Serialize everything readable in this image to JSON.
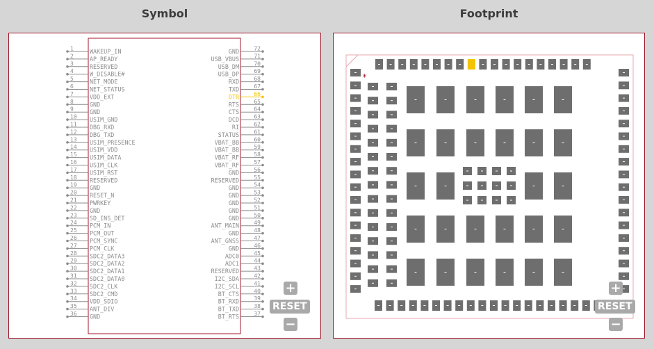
{
  "symbol_title": "Symbol",
  "footprint_title": "Footprint",
  "controls": {
    "plus": "+",
    "reset": "RESET",
    "minus": "−"
  },
  "colors": {
    "border": "#a0182c",
    "pin": "#8c8c8c",
    "highlight": "#f5c400",
    "pad": "#6e6e6e"
  },
  "symbol": {
    "left_pins": [
      {
        "num": "1",
        "name": "WAKEUP_IN"
      },
      {
        "num": "2",
        "name": "AP_READY"
      },
      {
        "num": "3",
        "name": "RESERVED"
      },
      {
        "num": "4",
        "name": "W_DISABLE#"
      },
      {
        "num": "5",
        "name": "NET_MODE"
      },
      {
        "num": "6",
        "name": "NET_STATUS"
      },
      {
        "num": "7",
        "name": "VDD_EXT"
      },
      {
        "num": "8",
        "name": "GND"
      },
      {
        "num": "9",
        "name": "GND"
      },
      {
        "num": "10",
        "name": "USIM_GND"
      },
      {
        "num": "11",
        "name": "DBG_RXD"
      },
      {
        "num": "12",
        "name": "DBG_TXD"
      },
      {
        "num": "13",
        "name": "USIM_PRESENCE"
      },
      {
        "num": "14",
        "name": "USIM_VDD"
      },
      {
        "num": "15",
        "name": "USIM_DATA"
      },
      {
        "num": "16",
        "name": "USIM_CLK"
      },
      {
        "num": "17",
        "name": "USIM_RST"
      },
      {
        "num": "18",
        "name": "RESERVED"
      },
      {
        "num": "19",
        "name": "GND"
      },
      {
        "num": "20",
        "name": "RESET_N"
      },
      {
        "num": "21",
        "name": "PWRKEY"
      },
      {
        "num": "22",
        "name": "GND"
      },
      {
        "num": "23",
        "name": "SD_INS_DET"
      },
      {
        "num": "24",
        "name": "PCM_IN"
      },
      {
        "num": "25",
        "name": "PCM_OUT"
      },
      {
        "num": "26",
        "name": "PCM_SYNC"
      },
      {
        "num": "27",
        "name": "PCM_CLK"
      },
      {
        "num": "28",
        "name": "SDC2_DATA3"
      },
      {
        "num": "29",
        "name": "SDC2_DATA2"
      },
      {
        "num": "30",
        "name": "SDC2_DATA1"
      },
      {
        "num": "31",
        "name": "SDC2_DATA0"
      },
      {
        "num": "32",
        "name": "SDC2_CLK"
      },
      {
        "num": "33",
        "name": "SDC2_CMD"
      },
      {
        "num": "34",
        "name": "VDD_SDIO"
      },
      {
        "num": "35",
        "name": "ANT_DIV"
      },
      {
        "num": "36",
        "name": "GND"
      }
    ],
    "right_pins": [
      {
        "num": "72",
        "name": "GND"
      },
      {
        "num": "71",
        "name": "USB_VBUS"
      },
      {
        "num": "70",
        "name": "USB_DM"
      },
      {
        "num": "69",
        "name": "USB_DP"
      },
      {
        "num": "68",
        "name": "RXD"
      },
      {
        "num": "67",
        "name": "TXD"
      },
      {
        "num": "66",
        "name": "DTR",
        "highlight": true
      },
      {
        "num": "65",
        "name": "RTS"
      },
      {
        "num": "64",
        "name": "CTS"
      },
      {
        "num": "63",
        "name": "DCD"
      },
      {
        "num": "62",
        "name": "RI"
      },
      {
        "num": "61",
        "name": "STATUS"
      },
      {
        "num": "60",
        "name": "VBAT_BB"
      },
      {
        "num": "59",
        "name": "VBAT_BB"
      },
      {
        "num": "58",
        "name": "VBAT_RF"
      },
      {
        "num": "57",
        "name": "VBAT_RF"
      },
      {
        "num": "56",
        "name": "GND"
      },
      {
        "num": "55",
        "name": "RESERVED"
      },
      {
        "num": "54",
        "name": "GND"
      },
      {
        "num": "53",
        "name": "GND"
      },
      {
        "num": "52",
        "name": "GND"
      },
      {
        "num": "51",
        "name": "GND"
      },
      {
        "num": "50",
        "name": "GND"
      },
      {
        "num": "49",
        "name": "ANT_MAIN"
      },
      {
        "num": "48",
        "name": "GND"
      },
      {
        "num": "47",
        "name": "ANT_GNSS"
      },
      {
        "num": "46",
        "name": "GND"
      },
      {
        "num": "45",
        "name": "ADC0"
      },
      {
        "num": "44",
        "name": "ADC1"
      },
      {
        "num": "43",
        "name": "RESERVED"
      },
      {
        "num": "42",
        "name": "I2C_SDA"
      },
      {
        "num": "41",
        "name": "I2C_SCL"
      },
      {
        "num": "40",
        "name": "BT_CTS"
      },
      {
        "num": "39",
        "name": "BT_RXD"
      },
      {
        "num": "38",
        "name": "BT_TXD"
      },
      {
        "num": "37",
        "name": "BT_RTS"
      }
    ]
  },
  "footprint": {
    "pin1_marker": "*",
    "highlight_pad": 66
  }
}
